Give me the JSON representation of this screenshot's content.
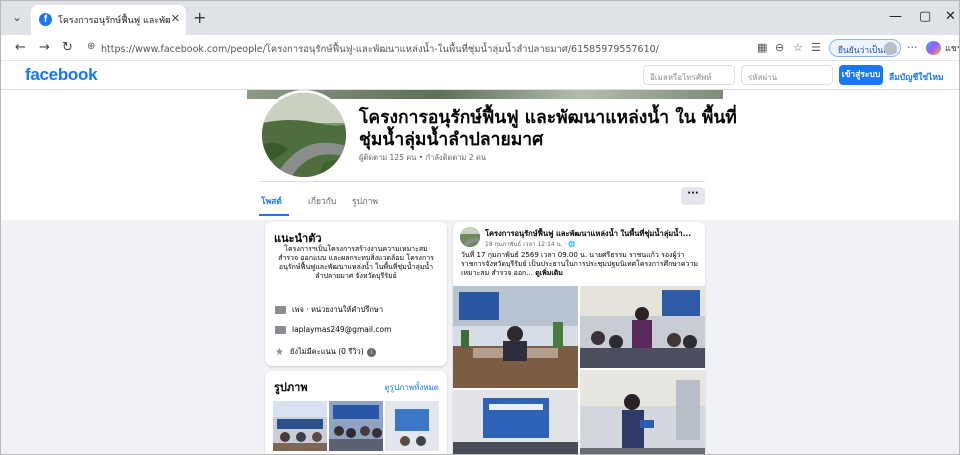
{
  "browser": {
    "tab_title": "โครงการอนุรักษ์ฟื้นฟู และพัฒนาแหล่งน้ำ ใน",
    "url": "https://www.facebook.com/people/โครงการอนุรักษ์ฟื้นฟู-และพัฒนาแหล่งน้ำ-ในพื้นที่ชุ่มน้ำลุ่มน้ำลำปลายมาศ/61585979557610/",
    "profile_label": "ยืนยันว่าเป็นคุณ",
    "extra_label": "แชร"
  },
  "facebook": {
    "logo": "facebook",
    "email_placeholder": "อีเมลหรือโทรศัพท์",
    "password_placeholder": "รหัสผ่าน",
    "login_label": "เข้าสู่ระบบ",
    "signup_label": "ลืมบัญชีใช่ไหม"
  },
  "page": {
    "name": "โครงการอนุรักษ์ฟื้นฟู และพัฒนาแหล่งน้ำ ใน พื้นที่ชุ่มน้ำลุ่มน้ำลำปลายมาศ",
    "followers": "ผู้ติดตาม 125 คน • กำลังติดตาม 2 คน",
    "tabs": [
      {
        "label": "โพสต์"
      },
      {
        "label": "เกี่ยวกับ"
      },
      {
        "label": "รูปภาพ"
      }
    ],
    "more": "···"
  },
  "intro": {
    "heading": "แนะนำตัว",
    "bio": "โครงการฯเป็นโครงการสร้างงานความเหมาะสม สำรวจ ออกแบบ และผลกระทบสิ่งแวดล้อม โครงการอนุรักษ์ฟื้นฟูและพัฒนาแหล่งน้ำ ในพื้นที่ชุ่มน้ำลุ่มน้ำลำปลายมาศ จังหวัดบุรีรัมย์",
    "category": "เพจ · หน่วยงานให้คำปรึกษา",
    "email": "laplaymas249@gmail.com",
    "rating": "ยังไม่มีคะแนน (0 รีวิว)"
  },
  "photos": {
    "heading": "รูปภาพ",
    "see_all": "ดูรูปภาพทั้งหมด"
  },
  "post": {
    "author": "โครงการอนุรักษ์ฟื้นฟู และพัฒนาแหล่งน้ำ ในพื้นที่ชุ่มน้ำลุ่มน้ำ...",
    "time": "18 กุมภาพันธ์ เวลา 12:14 น. · 🌐",
    "text": "วันที่ 17 กุมภาพันธ์ 2569 เวลา 09.00 น. นายศรีธรรม ราชนแก้ว รองผู้ว่าราชการจังหวัดบุรีรัมย์ เป็นประธานในการประชุมปฐมนิเทศโครงการศึกษาความเหมาะสม สำรวจ ออก...",
    "see_more": "ดูเพิ่มเติม"
  }
}
